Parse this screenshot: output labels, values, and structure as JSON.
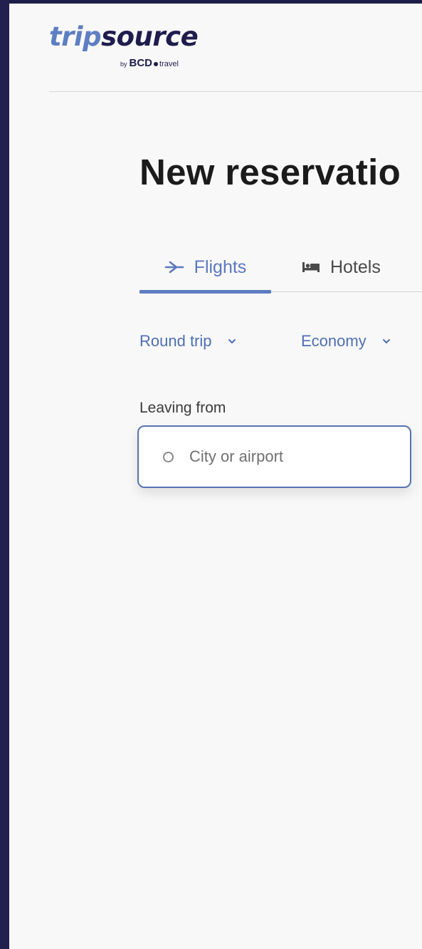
{
  "brand": {
    "name_part1": "trip",
    "name_part2": "source",
    "by": "by",
    "partner": "BCD",
    "partner_suffix": "travel"
  },
  "page": {
    "title": "New reservatio"
  },
  "tabs": [
    {
      "label": "Flights",
      "icon": "airplane-icon",
      "active": true
    },
    {
      "label": "Hotels",
      "icon": "bed-icon",
      "active": false
    }
  ],
  "trip_type": {
    "value": "Round trip"
  },
  "cabin_class": {
    "value": "Economy"
  },
  "origin": {
    "label": "Leaving from",
    "value": "",
    "placeholder": "City or airport"
  },
  "colors": {
    "accent": "#5d7cc1",
    "brand_dark": "#1f1d4d",
    "frame": "#22204f",
    "background": "#f8f8f8"
  }
}
